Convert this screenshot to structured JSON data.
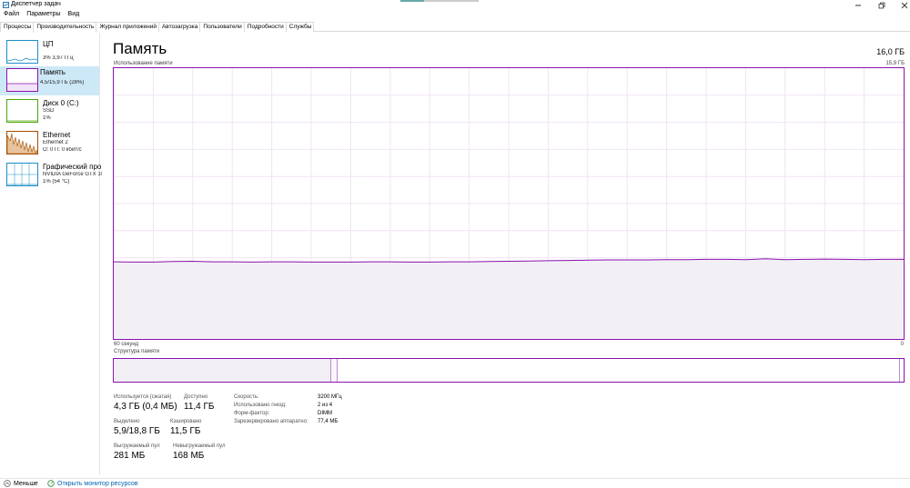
{
  "window": {
    "title": "Диспетчер задач"
  },
  "menu": [
    "Файл",
    "Параметры",
    "Вид"
  ],
  "tabs": [
    "Процессы",
    "Производительность",
    "Журнал приложений",
    "Автозагрузка",
    "Пользователи",
    "Подробности",
    "Службы"
  ],
  "active_tab": "Производительность",
  "sidebar": {
    "items": [
      {
        "name": "ЦП",
        "line1": "3% 3,97 ГГц",
        "line2": "",
        "color": "#1d8fc7",
        "icon": "cpu-thumbnail"
      },
      {
        "name": "Память",
        "line1": "4,5/15,9 ГБ (28%)",
        "line2": "",
        "color": "#8b12ae",
        "icon": "memory-thumbnail"
      },
      {
        "name": "Диск 0 (C:)",
        "line1": "SSD",
        "line2": "1%",
        "color": "#4da60c",
        "icon": "disk-thumbnail"
      },
      {
        "name": "Ethernet",
        "line1": "Ethernet 2",
        "line2": "О: 0 П: 0 кбит/с",
        "color": "#a74f01",
        "icon": "ethernet-thumbnail"
      },
      {
        "name": "Графический про",
        "line1": "NVIDIA GeForce GTX 10",
        "line2": "1% (54 °C)",
        "color": "#1d8fc7",
        "icon": "gpu-thumbnail"
      }
    ]
  },
  "main": {
    "title": "Память",
    "total": "16,0 ГБ",
    "usage_label": "Использование памяти",
    "usage_max": "15,9 ГБ",
    "axis_left": "60 секунд",
    "axis_right": "0",
    "composition_label": "Структура памяти",
    "accent_color": "#8b12ae"
  },
  "stats": {
    "in_use_label": "Используется (сжатая)",
    "in_use_value": "4,3 ГБ (0,4 МБ)",
    "available_label": "Доступно",
    "available_value": "11,4 ГБ",
    "committed_label": "Выделено",
    "committed_value": "5,9/18,8 ГБ",
    "cached_label": "Кэшировано",
    "cached_value": "11,5 ГБ",
    "paged_label": "Выгружаемый пул",
    "paged_value": "281 МБ",
    "nonpaged_label": "Невыгружаемый пул",
    "nonpaged_value": "168 МБ"
  },
  "details": {
    "speed_label": "Скорость:",
    "speed_value": "3200 МГц",
    "slots_label": "Использовано гнезд:",
    "slots_value": "2 из 4",
    "form_label": "Форм-фактор:",
    "form_value": "DIMM",
    "reserved_label": "Зарезервировано аппаратно:",
    "reserved_value": "77,4 МБ"
  },
  "footer": {
    "less_label": "Меньше",
    "monitor_label": "Открыть монитор ресурсов"
  },
  "memory_usage_history_percent": [
    28.5,
    28.4,
    28.4,
    28.6,
    28.7,
    28.5,
    28.5,
    28.4,
    28.5,
    28.5,
    28.4,
    28.4,
    28.4,
    28.5,
    28.5,
    28.4,
    28.4,
    28.5,
    28.5,
    28.6,
    28.7,
    28.8,
    28.9,
    29.0,
    29.1,
    29.2,
    29.2,
    29.2,
    29.3,
    29.3,
    29.4,
    29.4,
    29.3,
    29.6,
    29.3,
    29.4,
    29.5,
    29.4,
    29.3,
    29.4,
    29.4
  ]
}
